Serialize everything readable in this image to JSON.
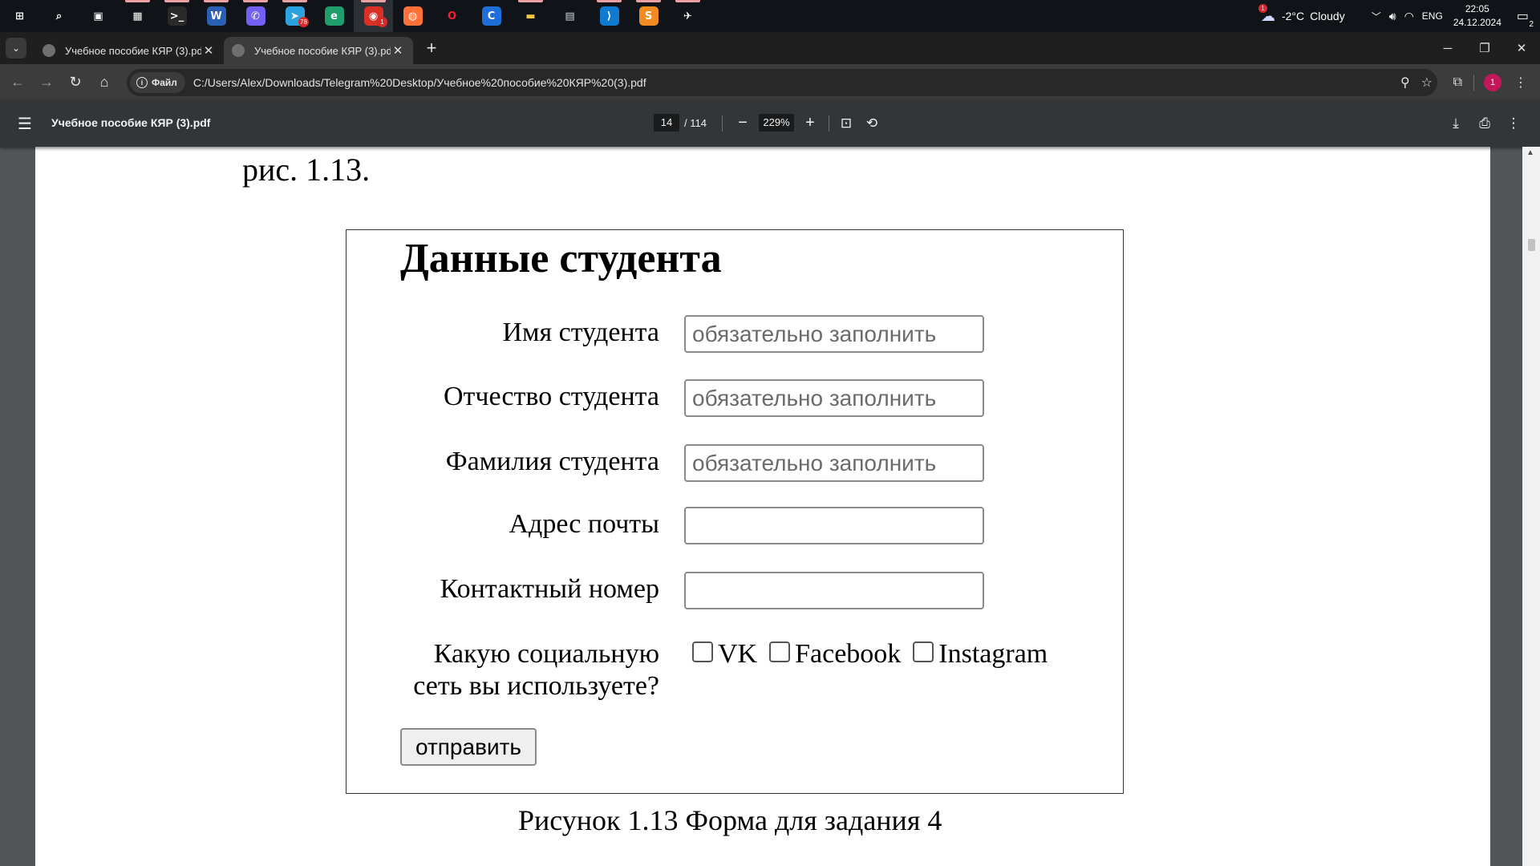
{
  "taskbar": {
    "apps": [
      {
        "name": "start-icon",
        "glyph": "⊞",
        "color": "#ffffff",
        "bg": "transparent",
        "running": false
      },
      {
        "name": "search-icon",
        "glyph": "⌕",
        "color": "#ffffff",
        "bg": "transparent",
        "running": false
      },
      {
        "name": "task-view-icon",
        "glyph": "▣",
        "color": "#ffffff",
        "bg": "transparent",
        "running": false
      },
      {
        "name": "calculator-icon",
        "glyph": "▦",
        "color": "#ffffff",
        "bg": "transparent",
        "running": true
      },
      {
        "name": "terminal-icon",
        "glyph": ">_",
        "color": "#ffffff",
        "bg": "#2a2a2a",
        "running": true
      },
      {
        "name": "word-icon",
        "glyph": "W",
        "color": "#ffffff",
        "bg": "#2b5fb4",
        "running": true
      },
      {
        "name": "viber-icon",
        "glyph": "✆",
        "color": "#ffffff",
        "bg": "#7360f2",
        "running": true
      },
      {
        "name": "telegram-icon",
        "glyph": "➤",
        "color": "#ffffff",
        "bg": "#2aa3de",
        "running": true,
        "badge": "78"
      },
      {
        "name": "edge-icon",
        "glyph": "e",
        "color": "#ffffff",
        "bg": "#1f9e6b",
        "running": false
      },
      {
        "name": "chrome-icon",
        "glyph": "◉",
        "color": "#ffffff",
        "bg": "#d93025",
        "running": true,
        "active": true,
        "badge": "1"
      },
      {
        "name": "firefox-icon",
        "glyph": "◍",
        "color": "#ffffff",
        "bg": "#ff7139",
        "running": false
      },
      {
        "name": "opera-icon",
        "glyph": "O",
        "color": "#ff1b2d",
        "bg": "transparent",
        "running": false
      },
      {
        "name": "c-app-icon",
        "glyph": "C",
        "color": "#ffffff",
        "bg": "#1e6fd9",
        "running": false
      },
      {
        "name": "file-explorer-icon",
        "glyph": "▬",
        "color": "#f5c542",
        "bg": "transparent",
        "running": true
      },
      {
        "name": "printer-app-icon",
        "glyph": "▤",
        "color": "#cfd8dc",
        "bg": "transparent",
        "running": false
      },
      {
        "name": "vscode-icon",
        "glyph": "⟩",
        "color": "#ffffff",
        "bg": "#0e7ad1",
        "running": true
      },
      {
        "name": "sublime-icon",
        "glyph": "S",
        "color": "#ffffff",
        "bg": "#f28b22",
        "running": true
      },
      {
        "name": "bird-app-icon",
        "glyph": "✈",
        "color": "#ffffff",
        "bg": "transparent",
        "running": true
      }
    ],
    "weather_temp": "-2°C",
    "weather_text": "Cloudy",
    "weather_badge": "1",
    "language": "ENG",
    "time": "22:05",
    "date": "24.12.2024",
    "notification_count": "2"
  },
  "browser": {
    "tabs": [
      {
        "title": "Учебное пособие КЯР (3).pdf",
        "active": false
      },
      {
        "title": "Учебное пособие КЯР (3).pdf",
        "active": true
      }
    ],
    "chip_label": "Файл",
    "url": "C:/Users/Alex/Downloads/Telegram%20Desktop/Учебное%20пособие%20КЯР%20(3).pdf",
    "profile_initial": "1"
  },
  "pdf": {
    "title": "Учебное пособие КЯР (3).pdf",
    "current_page": "14",
    "total_pages": "/ 114",
    "zoom": "229%"
  },
  "page": {
    "top_text": "рис. 1.13.",
    "figure_title": "Данные студента",
    "fields": [
      {
        "label": "Имя студента",
        "placeholder": "обязательно заполнить"
      },
      {
        "label": "Отчество студента",
        "placeholder": "обязательно заполнить"
      },
      {
        "label": "Фамилия студента",
        "placeholder": "обязательно заполнить"
      },
      {
        "label": "Адрес почты",
        "placeholder": ""
      },
      {
        "label": "Контактный номер",
        "placeholder": ""
      }
    ],
    "social_label_line1": "Какую социальную",
    "social_label_line2": "сеть вы используете?",
    "social_options": [
      "VK",
      "Facebook",
      "Instagram"
    ],
    "submit_label": "отправить",
    "caption": "Рисунок 1.13 Форма для задания 4"
  }
}
